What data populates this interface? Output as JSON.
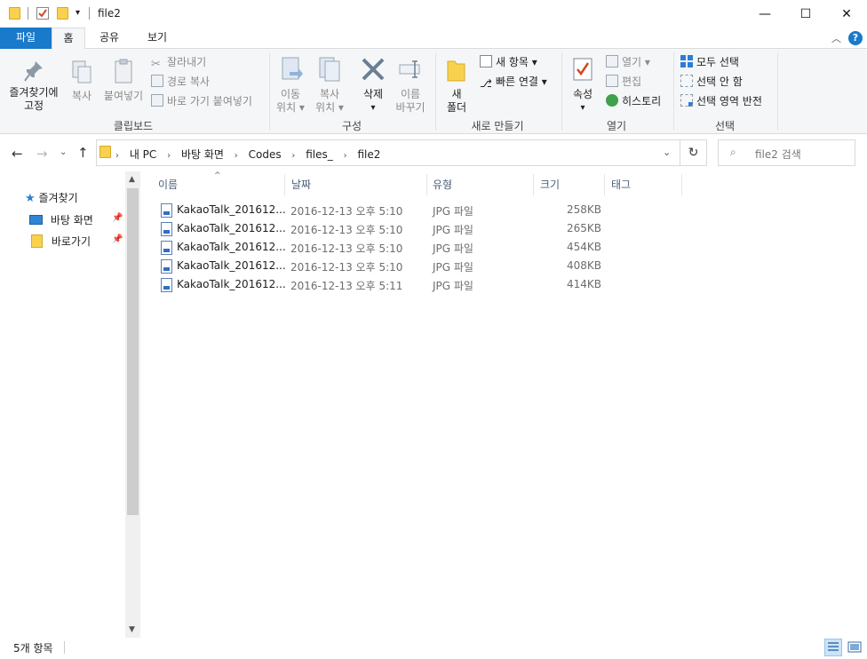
{
  "window": {
    "title": "file2",
    "controls": {
      "minimize": "—",
      "maximize": "☐",
      "close": "✕"
    }
  },
  "ribbon_tabs": [
    {
      "label": "파일"
    },
    {
      "label": "홈"
    },
    {
      "label": "공유"
    },
    {
      "label": "보기"
    }
  ],
  "ribbon": {
    "clipboard": {
      "label": "클립보드",
      "pin": "즐겨찾기에\n고정",
      "pin_line1": "즐겨찾기에",
      "pin_line2": "고정",
      "copy": "복사",
      "paste": "붙여넣기",
      "cut": "잘라내기",
      "copy_path": "경로 복사",
      "paste_shortcut": "바로 가기 붙여넣기"
    },
    "organize": {
      "label": "구성",
      "move_line1": "이동",
      "move_line2": "위치 ▾",
      "copy_line1": "복사",
      "copy_line2": "위치 ▾",
      "delete": "삭제",
      "delete_arrow": "▾",
      "rename_line1": "이름",
      "rename_line2": "바꾸기"
    },
    "new": {
      "label": "새로 만들기",
      "folder_line1": "새",
      "folder_line2": "폴더",
      "new_item": "새 항목 ▾",
      "easy_access": "빠른 연결 ▾"
    },
    "open": {
      "label": "열기",
      "properties": "속성",
      "properties_arrow": "▾",
      "open": "열기 ▾",
      "edit": "편집",
      "history": "히스토리"
    },
    "select": {
      "label": "선택",
      "select_all": "모두 선택",
      "select_none": "선택 안 함",
      "invert": "선택 영역 반전"
    }
  },
  "address": {
    "crumbs": [
      "내 PC",
      "바탕 화면",
      "Codes",
      "files_",
      "file2"
    ],
    "search_placeholder": "file2 검색"
  },
  "nav": {
    "quick_access": "즐겨찾기",
    "items": [
      {
        "label": "바탕 화면"
      },
      {
        "label": "바로가기"
      }
    ]
  },
  "columns": {
    "name": "이름",
    "date": "날짜",
    "type": "유형",
    "size": "크기",
    "tags": "태그"
  },
  "files": [
    {
      "name": "KakaoTalk_201612...",
      "date": "2016-12-13 오후 5:10",
      "type": "JPG 파일",
      "size": "258KB"
    },
    {
      "name": "KakaoTalk_201612...",
      "date": "2016-12-13 오후 5:10",
      "type": "JPG 파일",
      "size": "265KB"
    },
    {
      "name": "KakaoTalk_201612...",
      "date": "2016-12-13 오후 5:10",
      "type": "JPG 파일",
      "size": "454KB"
    },
    {
      "name": "KakaoTalk_201612...",
      "date": "2016-12-13 오후 5:10",
      "type": "JPG 파일",
      "size": "408KB"
    },
    {
      "name": "KakaoTalk_201612...",
      "date": "2016-12-13 오후 5:11",
      "type": "JPG 파일",
      "size": "414KB"
    }
  ],
  "status": {
    "count": "5개 항목"
  },
  "colors": {
    "accent": "#1979ca",
    "ribbon_bg": "#f5f6f7",
    "folder": "#f8d24e"
  }
}
